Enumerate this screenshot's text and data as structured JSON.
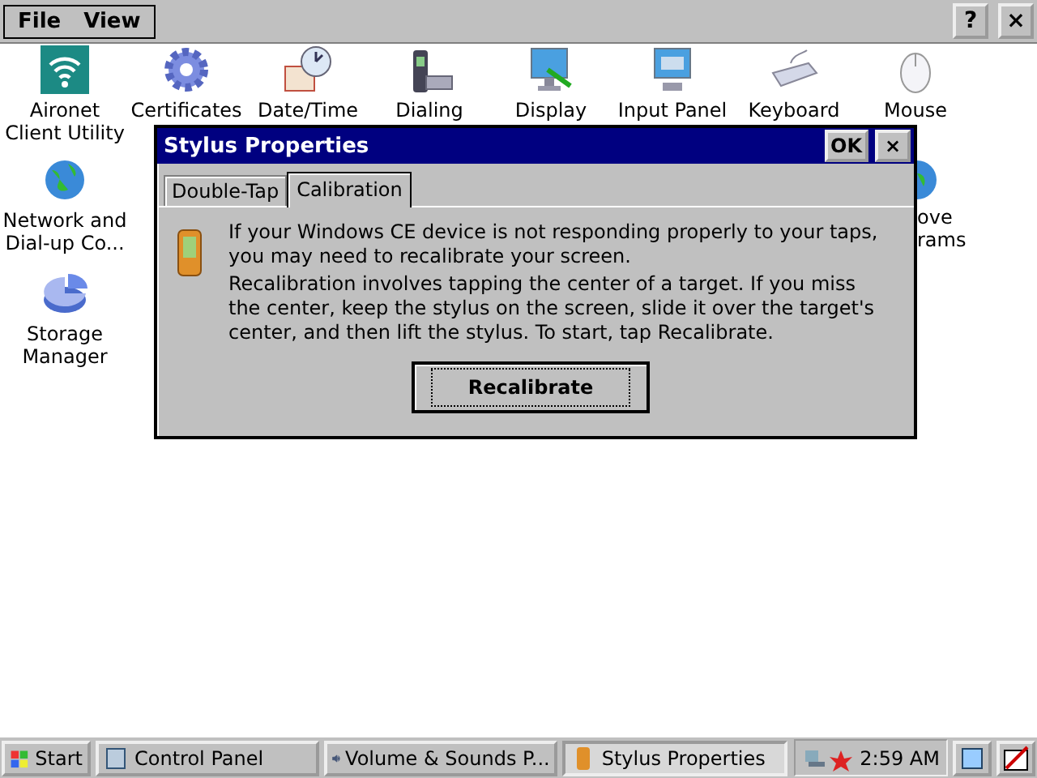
{
  "menu": [
    "File",
    "View"
  ],
  "title_buttons": [
    "?",
    "×"
  ],
  "icons": [
    {
      "kind": "wifi",
      "label": "Aironet Client Utility"
    },
    {
      "kind": "gear",
      "label": "Certificates"
    },
    {
      "kind": "clock",
      "label": "Date/Time"
    },
    {
      "kind": "phone",
      "label": "Dialing"
    },
    {
      "kind": "display",
      "label": "Display"
    },
    {
      "kind": "monitor",
      "label": "Input Panel"
    },
    {
      "kind": "keyboard",
      "label": "Keyboard"
    },
    {
      "kind": "mouse",
      "label": "Mouse"
    },
    {
      "kind": "globe",
      "label": "Network and Dial-up Co..."
    },
    {
      "kind": "pie",
      "label": "Storage Manager"
    }
  ],
  "partial_icon": {
    "kind": "globe",
    "lines": [
      "ove",
      "rams"
    ]
  },
  "dialog": {
    "title": "Stylus Properties",
    "ok": "OK",
    "close": "×",
    "tabs": [
      {
        "label": "Double-Tap",
        "selected": false
      },
      {
        "label": "Calibration",
        "selected": true
      }
    ],
    "paragraphs": [
      "If your Windows CE device is not responding properly to your taps, you may need to recalibrate your screen.",
      "Recalibration involves tapping the center of a target. If you miss the center, keep the stylus on the screen, slide it over the target's center, and then lift the stylus. To start, tap Recalibrate."
    ],
    "button": "Recalibrate"
  },
  "taskbar": {
    "start": "Start",
    "tasks": [
      {
        "label": "Control Panel",
        "selected": false
      },
      {
        "label": "Volume & Sounds P...",
        "selected": false
      },
      {
        "label": "Stylus Properties",
        "selected": true
      }
    ],
    "time": "2:59 AM"
  }
}
